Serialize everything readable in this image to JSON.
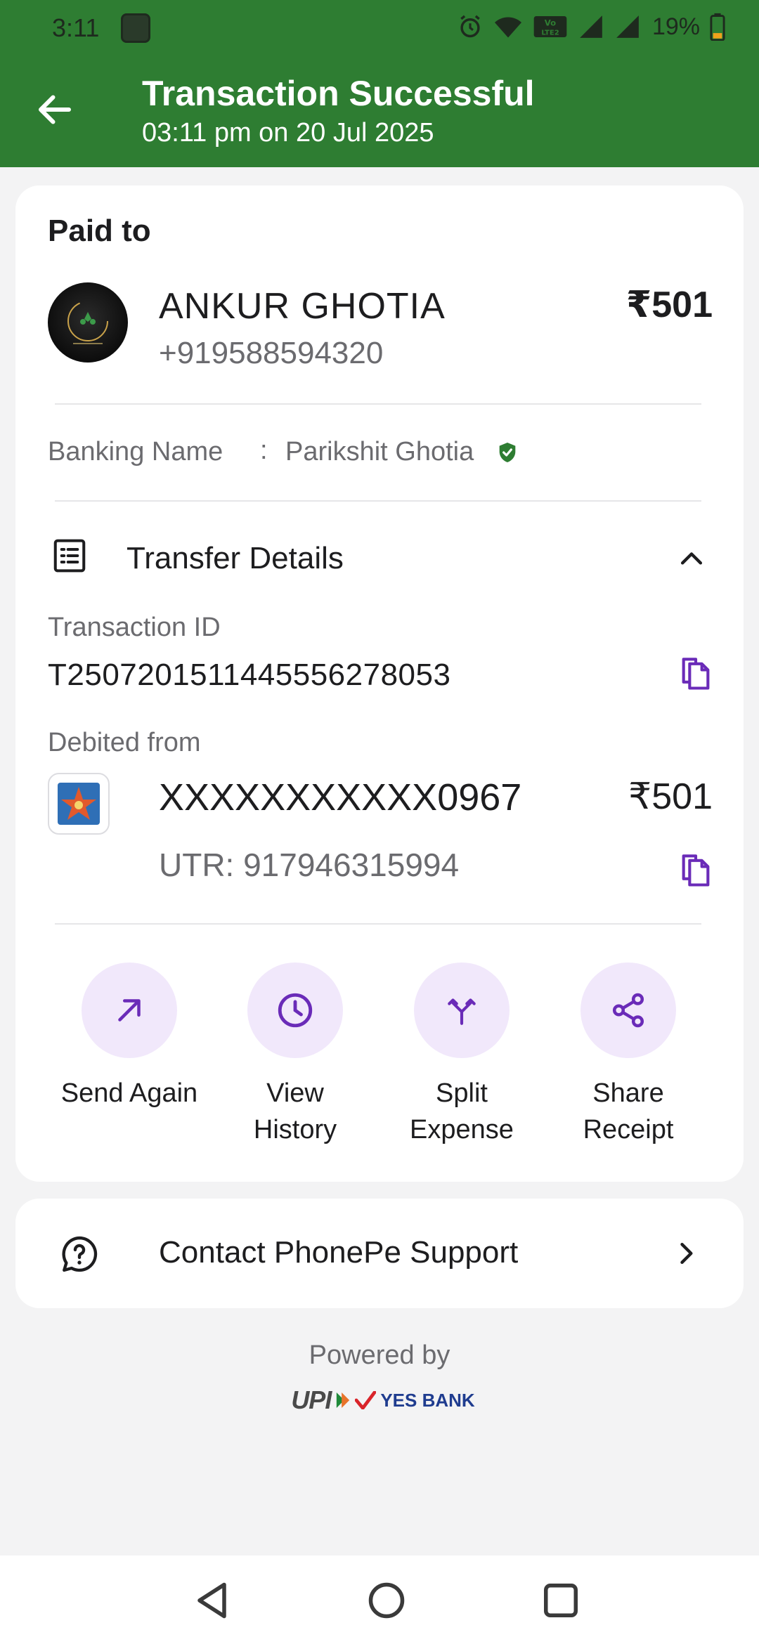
{
  "status_bar": {
    "time": "3:11",
    "battery": "19%",
    "icons": [
      "app-icon",
      "alarm-icon",
      "wifi-icon",
      "volte-icon",
      "signal-icon",
      "signal-icon",
      "battery-icon"
    ]
  },
  "header": {
    "title": "Transaction Successful",
    "subtitle": "03:11 pm on 20 Jul 2025",
    "background": "#2e7d32",
    "back_icon": "arrow-left-icon"
  },
  "paid_to": {
    "heading": "Paid to",
    "name": "ANKUR GHOTIA",
    "phone": "+919588594320",
    "amount": "₹501",
    "banking_name_label": "Banking Name",
    "banking_name_separator": ":",
    "banking_name_value": "Parikshit Ghotia",
    "verified_icon": "verified-shield-icon"
  },
  "transfer_details": {
    "title": "Transfer Details",
    "expanded": true,
    "transaction_id_label": "Transaction ID",
    "transaction_id": "T2507201511445556278053",
    "debited_from_label": "Debited from",
    "account_number": "XXXXXXXXXXX0967",
    "debit_amount": "₹501",
    "utr": "UTR: 917946315994"
  },
  "actions": [
    {
      "label": "Send Again",
      "icon": "arrow-up-right-icon"
    },
    {
      "label": "View\nHistory",
      "icon": "clock-icon"
    },
    {
      "label": "Split\nExpense",
      "icon": "split-icon"
    },
    {
      "label": "Share\nReceipt",
      "icon": "share-icon"
    }
  ],
  "support": {
    "label": "Contact PhonePe Support",
    "icon": "help-circle-icon"
  },
  "footer": {
    "powered_by": "Powered by",
    "upi_logo_text": "UPI",
    "bank_logo_text": "YES BANK"
  },
  "accent_color": "#6a2bb8",
  "action_bg_color": "#f1e8fb"
}
